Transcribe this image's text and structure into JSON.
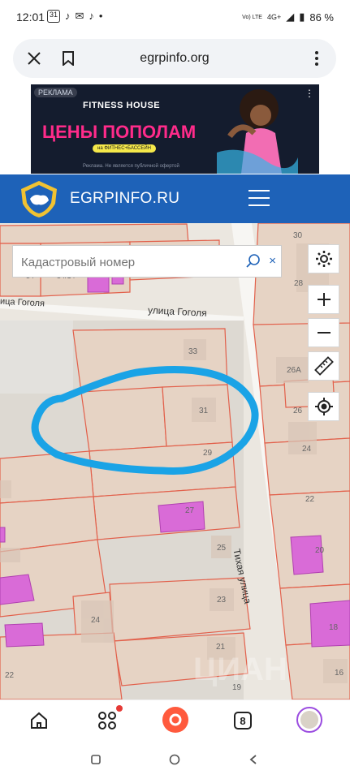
{
  "status_bar": {
    "time": "12:01",
    "left_icons": [
      "calendar-icon",
      "tiktok-icon",
      "mail-icon",
      "tiktok-icon",
      "dot-icon"
    ],
    "calendar_label": "31",
    "network": "4G+",
    "volte": "Vo) LTE",
    "battery": "86 %"
  },
  "browser": {
    "url": "egrpinfo.org"
  },
  "ad": {
    "tag": "РЕКЛАМА",
    "brand": "FITNESS HOUSE",
    "headline": "ЦЕНЫ ПОПОЛАМ",
    "pill": "на ФИТНЕС+БАССЕЙН",
    "fine_print": "Реклама. Не является публичной офертой"
  },
  "header": {
    "site_name": "EGRPINFO.RU"
  },
  "search": {
    "placeholder": "Кадастровый номер",
    "clear": "×"
  },
  "map": {
    "streets": [
      "улица Гоголя",
      "Тихая улица",
      "улица Гоголя"
    ],
    "street_abbrev": "ица Гоголя",
    "plots": [
      "30",
      "28",
      "33",
      "26А",
      "31",
      "26",
      "29",
      "24",
      "22",
      "27",
      "25",
      "20",
      "23",
      "24",
      "18",
      "21",
      "16",
      "19",
      "22",
      "34",
      "34/14"
    ],
    "annotation_color": "#1aa3e6",
    "watermark": "ЦИАН"
  },
  "bottom_nav": {
    "tabs_count": "8"
  }
}
